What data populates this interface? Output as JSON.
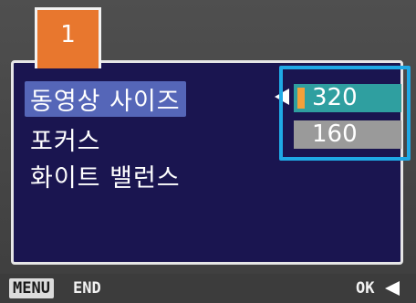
{
  "tab": {
    "number": "1"
  },
  "menu": {
    "items": [
      {
        "label": "동영상 사이즈",
        "selected": true
      },
      {
        "label": "포커스",
        "selected": false
      },
      {
        "label": "화이트 밸런스",
        "selected": false
      }
    ]
  },
  "options": [
    {
      "label": "320",
      "selected": true
    },
    {
      "label": "160",
      "selected": false
    }
  ],
  "footer": {
    "menu_key": "MENU",
    "menu_action": "END",
    "ok_key": "OK"
  },
  "colors": {
    "panel": "#1a1550",
    "tab": "#e8772e",
    "selected_row": "#5566b8",
    "highlight_box": "#1fa9e6",
    "option_selected": "#2f9fa0",
    "option_unselected": "#9a9a9a",
    "selection_marker": "#f4a03a"
  }
}
